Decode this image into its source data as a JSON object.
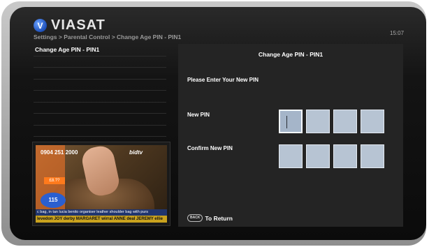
{
  "header": {
    "logo_text": "VIASAT",
    "logo_mark": "V",
    "breadcrumb": "Settings > Parental Control > Change Age PIN - PIN1",
    "clock": "15:07"
  },
  "menu": {
    "items": [
      "Change Age PIN - PIN1",
      "",
      "",
      "",
      "",
      "",
      "",
      ""
    ]
  },
  "tv_preview": {
    "phone": "0904 251 2000",
    "brand": "bidtv",
    "price": "£8.??",
    "quantity_left": "115",
    "ticker_top": "c bag, in tan     lucia benito organiser leather shoulder bag with purs",
    "ticker_bottom": "levedon  JOY  derby  MARGARET  wirral  ANNE  deal  JEREMY  ellie"
  },
  "panel": {
    "title": "Change Age PIN - PIN1",
    "prompt": "Please Enter Your New PIN",
    "new_pin_label": "New PIN",
    "confirm_pin_label": "Confirm New PIN",
    "back_key": "BACK",
    "back_text": "To Return"
  },
  "colors": {
    "pin_box": "#b7c4d3",
    "panel_bg": "#242424",
    "screen_bg": "#0b0b0b"
  }
}
